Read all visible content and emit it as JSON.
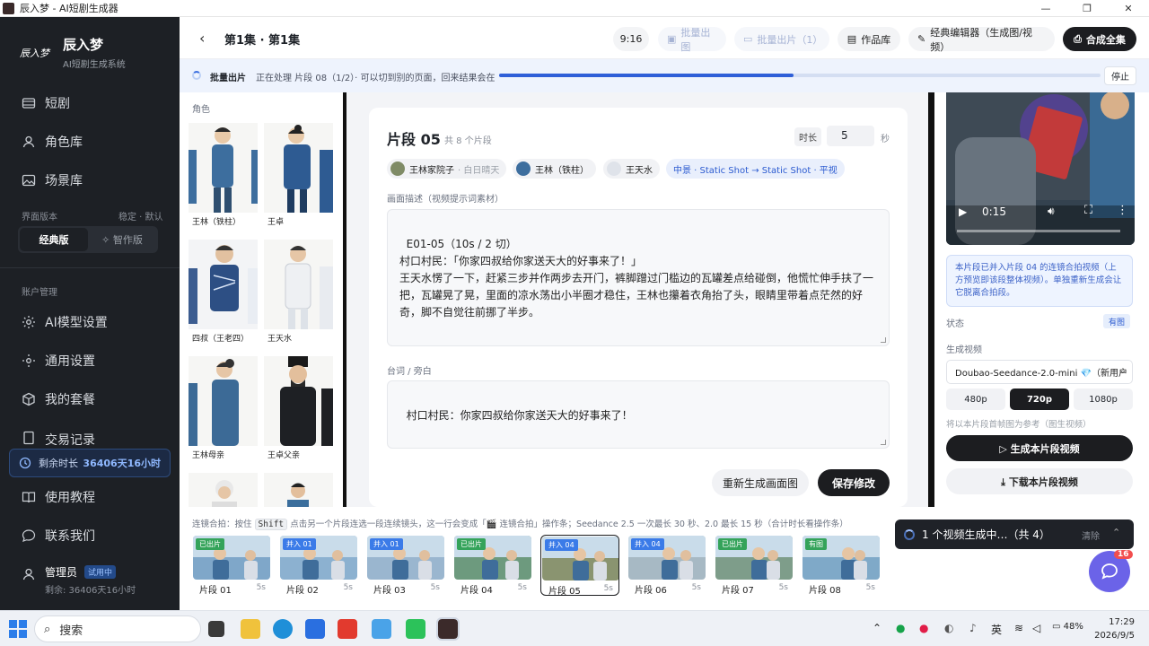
{
  "window": {
    "title": "辰入梦 - AI短剧生成器",
    "minimize": "—",
    "maximize": "❐",
    "close": "✕"
  },
  "brand": {
    "logo": "辰入梦",
    "name": "辰入梦",
    "subtitle": "AI短剧生成系统"
  },
  "nav": [
    {
      "label": "短剧",
      "icon": "film-icon"
    },
    {
      "label": "角色库",
      "icon": "user-icon"
    },
    {
      "label": "场景库",
      "icon": "image-icon"
    }
  ],
  "version": {
    "label": "界面版本",
    "hint": "稳定 · 默认",
    "classic": "经典版",
    "smart": "✧ 智作版"
  },
  "account": {
    "label": "账户管理",
    "items": [
      "AI模型设置",
      "通用设置",
      "我的套餐",
      "交易记录",
      "使用教程",
      "联系我们"
    ]
  },
  "remain": {
    "label": "剩余时长",
    "value": "36406天16小时"
  },
  "user": {
    "name": "管理员",
    "tag": "试用中",
    "remain": "剩余: 36406天16小时"
  },
  "header": {
    "episode": "第1集 · 第1集",
    "ratio": "9:16",
    "batch_image": "批量出图",
    "batch_clip": "批量出片（1）",
    "library": "作品库",
    "classic_editor": "经典编辑器（生成图/视频）",
    "compose": "合成全集"
  },
  "progress": {
    "title": "批量出片",
    "text": "正在处理 片段 08（1/2）· 可以切到别的页面，回来结果会在",
    "stop": "停止",
    "fraction": 0.49
  },
  "characters": {
    "label": "角色",
    "items": [
      "王林（铁柱）",
      "王卓",
      "四叔（王老四）",
      "王天水",
      "王林母亲",
      "王卓父亲"
    ]
  },
  "segment": {
    "title": "片段 05",
    "count": "共 8 个片段",
    "duration_label": "时长",
    "duration": "5",
    "duration_unit": "秒",
    "chips": [
      {
        "name": "王林家院子",
        "sub": "· 白日晴天"
      },
      {
        "name": "王林（铁柱）",
        "sub": ""
      },
      {
        "name": "王天水",
        "sub": ""
      }
    ],
    "shot": "中景 · Static Shot → Static Shot · 平视",
    "desc_label": "画面描述（视频提示词素材）",
    "desc": "E01-05（10s / 2 切）\n村口村民：「你家四叔给你家送天大的好事来了！」\n王天水愣了一下，赶紧三步并作两步去开门，裤脚蹭过门槛边的瓦罐差点给碰倒，他慌忙伸手扶了一把，瓦罐晃了晃，里面的凉水荡出小半圈才稳住，王林也攥着衣角抬了头，眼睛里带着点茫然的好奇，脚不自觉往前挪了半步。",
    "line_label": "台词 / 旁白",
    "line": "村口村民：你家四叔给你家送天大的好事来了！",
    "regen": "重新生成画面图",
    "save": "保存修改"
  },
  "right": {
    "video_time": "0:15",
    "notice": "本片段已并入片段 04 的连镜合拍视频（上方预览即该段整体视频）。单独重新生成会让它脱离合拍段。",
    "status_label": "状态",
    "status": "有图",
    "gen_label": "生成视频",
    "model": "Doubao-Seedance-2.0-mini 💎（新用户",
    "res": [
      "480p",
      "720p",
      "1080p"
    ],
    "ref_hint": "将以本片段首帧图为参考（图生视频）",
    "gen_btn": "▷ 生成本片段视频",
    "dl_btn": "⤓ 下载本片段视频"
  },
  "hint": {
    "a": "连镜合拍：按住",
    "key": "Shift",
    "b": "点击另一个片段连选一段连续镜头，这一行会变成「🎬 连镜合拍」操作条；Seedance 2.5 一次最长 30 秒、2.0 最长 15 秒（合计时长看操作条）"
  },
  "film": [
    {
      "name": "片段 01",
      "tag": "已出片",
      "dur": "5s"
    },
    {
      "name": "片段 02",
      "tag": "并入 01",
      "dur": "5s"
    },
    {
      "name": "片段 03",
      "tag": "并入 01",
      "dur": "5s"
    },
    {
      "name": "片段 04",
      "tag": "已出片",
      "dur": "5s"
    },
    {
      "name": "片段 05",
      "tag": "并入 04",
      "dur": "5s"
    },
    {
      "name": "片段 06",
      "tag": "并入 04",
      "dur": "5s"
    },
    {
      "name": "片段 07",
      "tag": "已出片",
      "dur": "5s"
    },
    {
      "name": "片段 08",
      "tag": "有图",
      "dur": "5s"
    }
  ],
  "toast": {
    "text": "1 个视频生成中…（共 4）",
    "clear": "清除"
  },
  "chat_badge": "16",
  "taskbar": {
    "search": "搜索",
    "ime": "英",
    "battery": "48%",
    "time": "17:29",
    "date": "2026/9/5"
  }
}
